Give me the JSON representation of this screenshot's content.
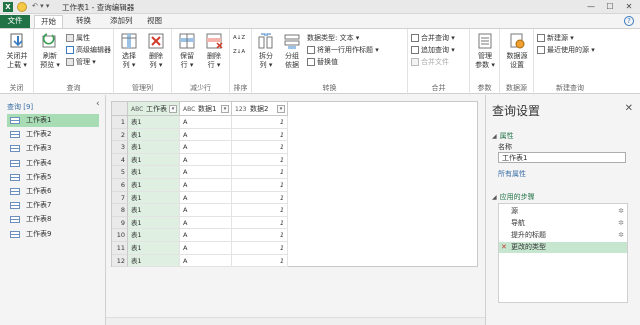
{
  "titlebar": {
    "app_icon": "X",
    "title": "工作表1 - 查询编辑器",
    "qat": "↶ ▾ ▾",
    "minimize": "—",
    "maximize": "☐",
    "close": "✕"
  },
  "tabs": {
    "file": "文件",
    "home": "开始",
    "transform": "转换",
    "add_column": "添加列",
    "view": "视图",
    "help": "?"
  },
  "ribbon": {
    "close_group": {
      "label": "关闭",
      "close_load": "关闭并\n上载 ▾"
    },
    "query_group": {
      "label": "查询",
      "refresh": "刷新\n预览 ▾",
      "properties": "属性",
      "advanced_editor": "高级编辑器",
      "manage": "管理 ▾"
    },
    "manage_cols_group": {
      "label": "管理列",
      "choose_cols": "选择\n列 ▾",
      "remove_cols": "删除\n列 ▾"
    },
    "reduce_rows_group": {
      "label": "减少行",
      "keep_rows": "保留\n行 ▾",
      "remove_rows": "删除\n行 ▾"
    },
    "sort_group": {
      "label": "排序",
      "asc": "A↓Z",
      "desc": "Z↓A"
    },
    "transform_group": {
      "label": "转换",
      "split": "拆分\n列 ▾",
      "group_by": "分组\n依据",
      "data_type": "数据类型: 文本 ▾",
      "first_row_header": "将第一行用作标题 ▾",
      "replace": "替换值"
    },
    "combine_group": {
      "label": "合并",
      "merge": "合并查询 ▾",
      "append": "追加查询 ▾",
      "merge_files": "合并文件"
    },
    "params_group": {
      "label": "参数",
      "manage_params": "管理\n参数 ▾"
    },
    "datasource_group": {
      "label": "数据源",
      "settings": "数据源\n设置"
    },
    "newquery_group": {
      "label": "新建查询",
      "new_source": "新建源 ▾",
      "recent": "最近使用的源 ▾"
    }
  },
  "queries": {
    "header": "查询 [9]",
    "collapse": "‹",
    "items": [
      "工作表1",
      "工作表2",
      "工作表3",
      "工作表4",
      "工作表5",
      "工作表6",
      "工作表7",
      "工作表8",
      "工作表9"
    ],
    "selected_index": 0
  },
  "grid": {
    "columns": [
      {
        "type": "ABC",
        "name": "工作表"
      },
      {
        "type": "ABC",
        "name": "数据1"
      },
      {
        "type": "123",
        "name": "数据2"
      }
    ],
    "rows": [
      [
        "1",
        "表1",
        "A",
        "1"
      ],
      [
        "2",
        "表1",
        "A",
        "1"
      ],
      [
        "3",
        "表1",
        "A",
        "1"
      ],
      [
        "4",
        "表1",
        "A",
        "1"
      ],
      [
        "5",
        "表1",
        "A",
        "1"
      ],
      [
        "6",
        "表1",
        "A",
        "1"
      ],
      [
        "7",
        "表1",
        "A",
        "1"
      ],
      [
        "8",
        "表1",
        "A",
        "1"
      ],
      [
        "9",
        "表1",
        "A",
        "1"
      ],
      [
        "10",
        "表1",
        "A",
        "1"
      ],
      [
        "11",
        "表1",
        "A",
        "1"
      ],
      [
        "12",
        "表1",
        "A",
        "1"
      ]
    ]
  },
  "settings": {
    "title": "查询设置",
    "close": "✕",
    "props_section": "属性",
    "name_label": "名称",
    "name_value": "工作表1",
    "all_props": "所有属性",
    "steps_section": "应用的步骤",
    "steps": [
      "源",
      "导航",
      "提升的标题",
      "更改的类型"
    ],
    "selected_step": 3
  },
  "colors": {
    "accent": "#217346",
    "selection": "#a7dcb4",
    "column_highlight": "#dff0e3"
  }
}
